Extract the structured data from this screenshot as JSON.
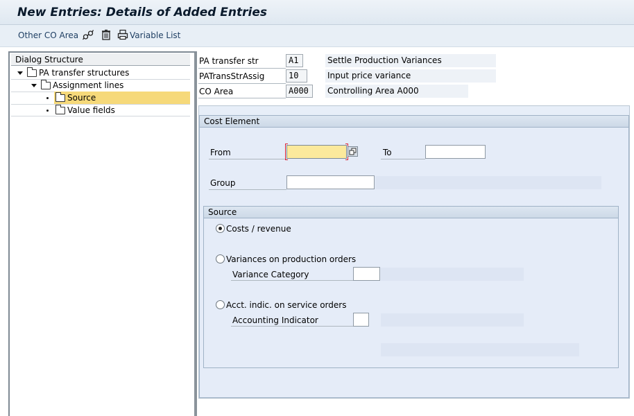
{
  "window": {
    "title": "New Entries: Details of Added Entries"
  },
  "toolbar": {
    "other_co_area": "Other CO Area",
    "variable_list": "Variable List",
    "icons": [
      "glasses-icon",
      "trash-icon",
      "printer-icon"
    ]
  },
  "dialog_structure": {
    "header": "Dialog Structure",
    "items": [
      {
        "label": "PA transfer structures",
        "level": 0,
        "expanded": true
      },
      {
        "label": "Assignment lines",
        "level": 1,
        "expanded": true
      },
      {
        "label": "Source",
        "level": 2,
        "selected": true
      },
      {
        "label": "Value fields",
        "level": 2,
        "selected": false
      }
    ]
  },
  "header_fields": {
    "pa_transfer_str": {
      "label": "PA transfer str",
      "value": "A1",
      "description": "Settle Production Variances"
    },
    "pa_trans_str_assig": {
      "label": "PATransStrAssig",
      "value": "10",
      "description": "Input price variance"
    },
    "co_area": {
      "label": "CO Area",
      "value": "A000",
      "description": "Controlling Area A000"
    }
  },
  "cost_element": {
    "title": "Cost Element",
    "from_label": "From",
    "from_value": "",
    "to_label": "To",
    "to_value": "",
    "group_label": "Group",
    "group_value": ""
  },
  "source": {
    "title": "Source",
    "options": [
      {
        "label": "Costs / revenue",
        "selected": true
      },
      {
        "label": "Variances on production orders",
        "selected": false
      },
      {
        "label": "Acct. indic. on service orders",
        "selected": false
      }
    ],
    "variance_category_label": "Variance Category",
    "variance_category_value": "",
    "accounting_indicator_label": "Accounting Indicator",
    "accounting_indicator_value": ""
  },
  "colors": {
    "focus_field": "#fbe99c",
    "selected_row": "#f6d97a",
    "frame": "#e7eef8"
  }
}
